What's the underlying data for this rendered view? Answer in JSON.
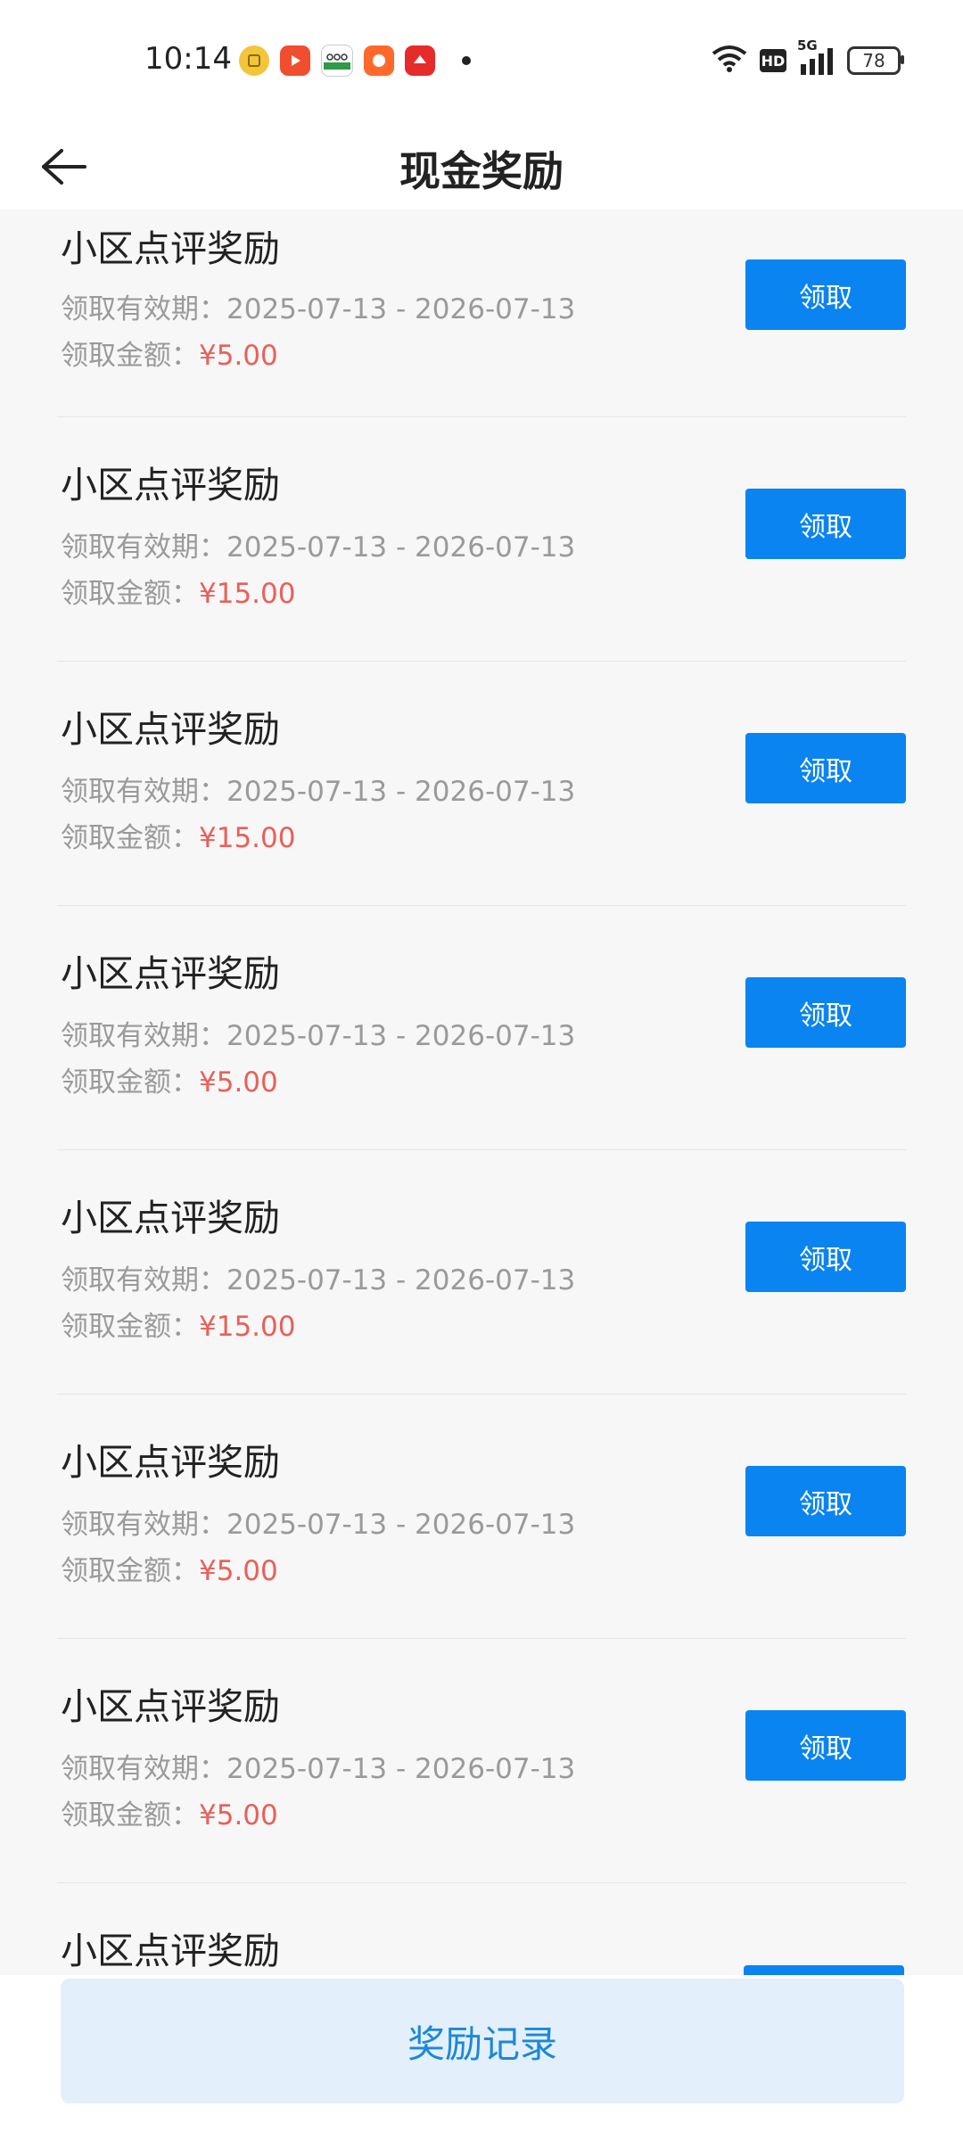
{
  "status_bar": {
    "time": "10:14",
    "network": "5G",
    "hd": "HD",
    "battery": "78"
  },
  "header": {
    "title": "现金奖励"
  },
  "rewards": [
    {
      "title": "小区点评奖励",
      "validity_label": "领取有效期：",
      "validity": "2025-07-13 - 2026-07-13",
      "amount_label": "领取金额：",
      "amount": "¥5.00",
      "button": "领取"
    },
    {
      "title": "小区点评奖励",
      "validity_label": "领取有效期：",
      "validity": "2025-07-13 - 2026-07-13",
      "amount_label": "领取金额：",
      "amount": "¥15.00",
      "button": "领取"
    },
    {
      "title": "小区点评奖励",
      "validity_label": "领取有效期：",
      "validity": "2025-07-13 - 2026-07-13",
      "amount_label": "领取金额：",
      "amount": "¥15.00",
      "button": "领取"
    },
    {
      "title": "小区点评奖励",
      "validity_label": "领取有效期：",
      "validity": "2025-07-13 - 2026-07-13",
      "amount_label": "领取金额：",
      "amount": "¥5.00",
      "button": "领取"
    },
    {
      "title": "小区点评奖励",
      "validity_label": "领取有效期：",
      "validity": "2025-07-13 - 2026-07-13",
      "amount_label": "领取金额：",
      "amount": "¥15.00",
      "button": "领取"
    },
    {
      "title": "小区点评奖励",
      "validity_label": "领取有效期：",
      "validity": "2025-07-13 - 2026-07-13",
      "amount_label": "领取金额：",
      "amount": "¥5.00",
      "button": "领取"
    },
    {
      "title": "小区点评奖励",
      "validity_label": "领取有效期：",
      "validity": "2025-07-13 - 2026-07-13",
      "amount_label": "领取金额：",
      "amount": "¥5.00",
      "button": "领取"
    },
    {
      "title": "小区点评奖励"
    }
  ],
  "bottom": {
    "records_button": "奖励记录"
  },
  "colors": {
    "primary": "#0a84f0",
    "amount": "#e8605a",
    "records_bg": "#e3f0fb",
    "records_text": "#1c88d9"
  }
}
